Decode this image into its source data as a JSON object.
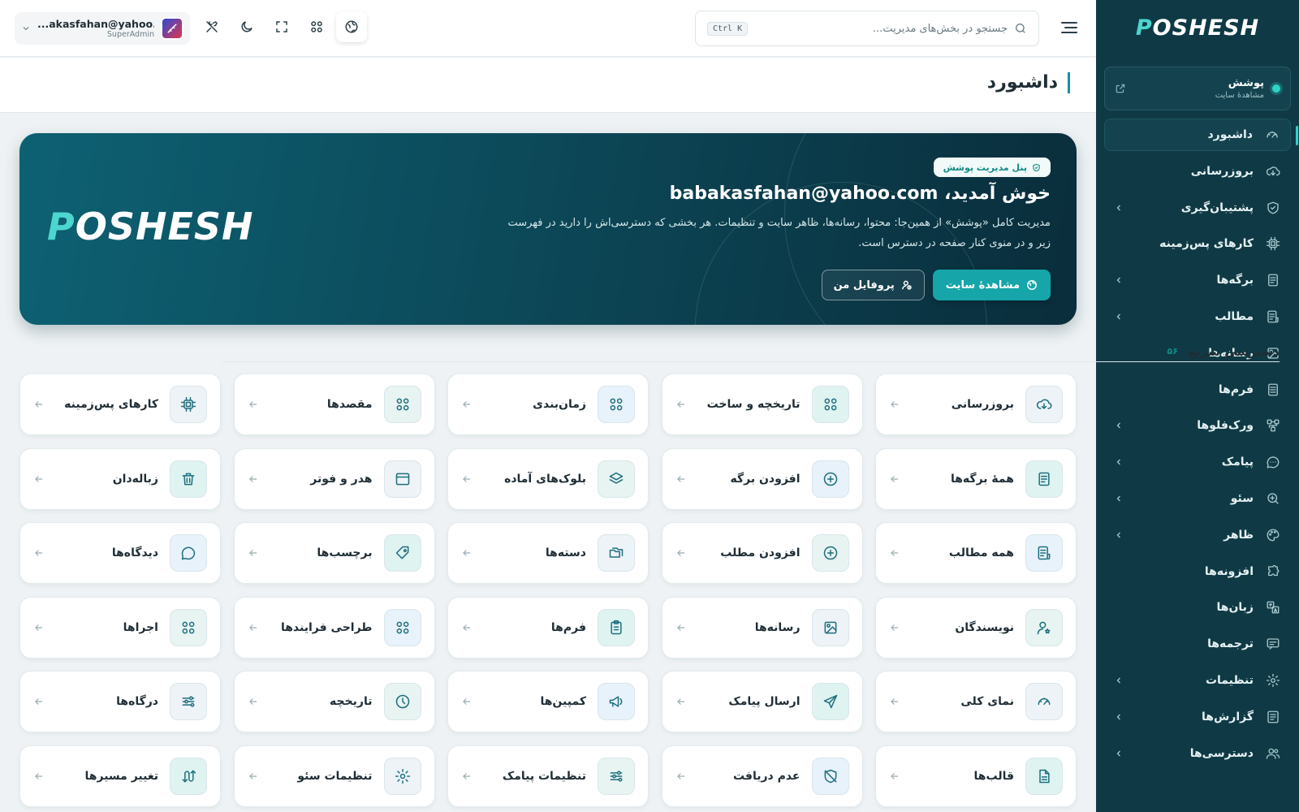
{
  "sidebar": {
    "brand": {
      "first": "P",
      "rest": "OSHESH"
    },
    "site": {
      "title": "پوشش",
      "subtitle": "مشاهدهٔ سایت"
    },
    "items": [
      {
        "label": "داشبورد",
        "icon": "gauge-icon",
        "chevron": false,
        "active": true
      },
      {
        "label": "بروزرسانی",
        "icon": "cloud-download-icon",
        "chevron": false
      },
      {
        "label": "پشتیبان‌گیری",
        "icon": "shield-icon",
        "chevron": true
      },
      {
        "label": "کارهای پس‌زمینه",
        "icon": "cpu-icon",
        "chevron": false
      },
      {
        "label": "برگه‌ها",
        "icon": "page-icon",
        "chevron": true
      },
      {
        "label": "مطالب",
        "icon": "posts-icon",
        "chevron": true
      },
      {
        "label": "رسانه‌ها",
        "icon": "image-icon",
        "chevron": false
      },
      {
        "label": "فرم‌ها",
        "icon": "form-icon",
        "chevron": false
      },
      {
        "label": "ورک‌فلوها",
        "icon": "workflow-icon",
        "chevron": true
      },
      {
        "label": "پیامک",
        "icon": "chat-icon",
        "chevron": true
      },
      {
        "label": "سئو",
        "icon": "seo-search-icon",
        "chevron": true
      },
      {
        "label": "ظاهر",
        "icon": "palette-icon",
        "chevron": true
      },
      {
        "label": "افزونه‌ها",
        "icon": "puzzle-icon",
        "chevron": false
      },
      {
        "label": "زبان‌ها",
        "icon": "language-icon",
        "chevron": false
      },
      {
        "label": "ترجمه‌ها",
        "icon": "translate-icon",
        "chevron": false
      },
      {
        "label": "تنظیمات",
        "icon": "gear-icon",
        "chevron": true
      },
      {
        "label": "گزارش‌ها",
        "icon": "report-icon",
        "chevron": true
      },
      {
        "label": "دسترسی‌ها",
        "icon": "users-icon",
        "chevron": true
      }
    ]
  },
  "topbar": {
    "search_placeholder": "جستجو در بخش‌های مدیریت...",
    "search_shortcut": "Ctrl K",
    "user": {
      "email": "...akasfahan@yahoo.com",
      "role": "SuperAdmin"
    }
  },
  "page": {
    "title": "داشبورد"
  },
  "hero": {
    "badge": "پنل مدیریت پوشش",
    "title": "خوش آمدید، babakasfahan@yahoo.com",
    "description": "مدیریت کامل «پوشش» از همین‌جا: محتوا، رسانه‌ها، ظاهر سایت و تنظیمات. هر بخشی که دسترسی‌اش را دارید در فهرست زیر و در منوی کنار صفحه در دسترس است.",
    "primary_button": "مشاهدهٔ سایت",
    "secondary_button": "پروفایل من",
    "logo": {
      "first": "P",
      "rest": "OSHESH"
    }
  },
  "quick_access": {
    "title": "دسترسی سریع",
    "count": "۵۶",
    "tiles": [
      {
        "label": "بروزرسانی",
        "icon": "cloud-download-icon",
        "bg": "#eef3f7"
      },
      {
        "label": "تاریخچه و ساخت",
        "icon": "grid-icon",
        "bg": "#dff3f1"
      },
      {
        "label": "زمان‌بندی",
        "icon": "grid-icon",
        "bg": "#e8f2fb"
      },
      {
        "label": "مقصدها",
        "icon": "grid-icon",
        "bg": "#e7f4f2"
      },
      {
        "label": "کارهای پس‌زمینه",
        "icon": "cpu-icon",
        "bg": "#eef3f7"
      },
      {
        "label": "همهٔ برگه‌ها",
        "icon": "page-icon",
        "bg": "#dff3f1"
      },
      {
        "label": "افزودن برگه",
        "icon": "plus-circle-icon",
        "bg": "#e8f2fb"
      },
      {
        "label": "بلوک‌های آماده",
        "icon": "layers-icon",
        "bg": "#e7f4f2"
      },
      {
        "label": "هدر و فوتر",
        "icon": "window-icon",
        "bg": "#eef3f7"
      },
      {
        "label": "زباله‌دان",
        "icon": "trash-icon",
        "bg": "#dff3f1"
      },
      {
        "label": "همه مطالب",
        "icon": "posts-icon",
        "bg": "#e8f2fb"
      },
      {
        "label": "افزودن مطلب",
        "icon": "plus-circle-icon",
        "bg": "#e7f4f2"
      },
      {
        "label": "دسته‌ها",
        "icon": "folders-icon",
        "bg": "#eef3f7"
      },
      {
        "label": "برچسب‌ها",
        "icon": "tag-icon",
        "bg": "#dff3f1"
      },
      {
        "label": "دیدگاه‌ها",
        "icon": "comment-icon",
        "bg": "#e8f2fb"
      },
      {
        "label": "نویسندگان",
        "icon": "user-star-icon",
        "bg": "#e7f4f2"
      },
      {
        "label": "رسانه‌ها",
        "icon": "image-icon",
        "bg": "#eef3f7"
      },
      {
        "label": "فرم‌ها",
        "icon": "clipboard-icon",
        "bg": "#dff3f1"
      },
      {
        "label": "طراحی فرایندها",
        "icon": "grid-icon",
        "bg": "#e8f2fb"
      },
      {
        "label": "اجراها",
        "icon": "grid-icon",
        "bg": "#e7f4f2"
      },
      {
        "label": "نمای کلی",
        "icon": "gauge-icon",
        "bg": "#eef3f7"
      },
      {
        "label": "ارسال پیامک",
        "icon": "send-icon",
        "bg": "#dff3f1"
      },
      {
        "label": "کمپین‌ها",
        "icon": "megaphone-icon",
        "bg": "#e8f2fb"
      },
      {
        "label": "تاریخچه",
        "icon": "clock-icon",
        "bg": "#e7f4f2"
      },
      {
        "label": "درگاه‌ها",
        "icon": "sliders-icon",
        "bg": "#eef3f7"
      },
      {
        "label": "قالب‌ها",
        "icon": "document-icon",
        "bg": "#dff3f1"
      },
      {
        "label": "عدم دریافت",
        "icon": "shield-off-icon",
        "bg": "#e8f2fb"
      },
      {
        "label": "تنظیمات پیامک",
        "icon": "sliders-icon",
        "bg": "#e7f4f2"
      },
      {
        "label": "تنظیمات سئو",
        "icon": "gear-icon",
        "bg": "#eef3f7"
      },
      {
        "label": "تغییر مسیرها",
        "icon": "redirect-icon",
        "bg": "#dff3f1"
      }
    ]
  },
  "colors": {
    "sidebar": "#0f3a45",
    "accent": "#16a5a8",
    "hero_start": "#0d6173",
    "hero_end": "#0a2d3b"
  }
}
